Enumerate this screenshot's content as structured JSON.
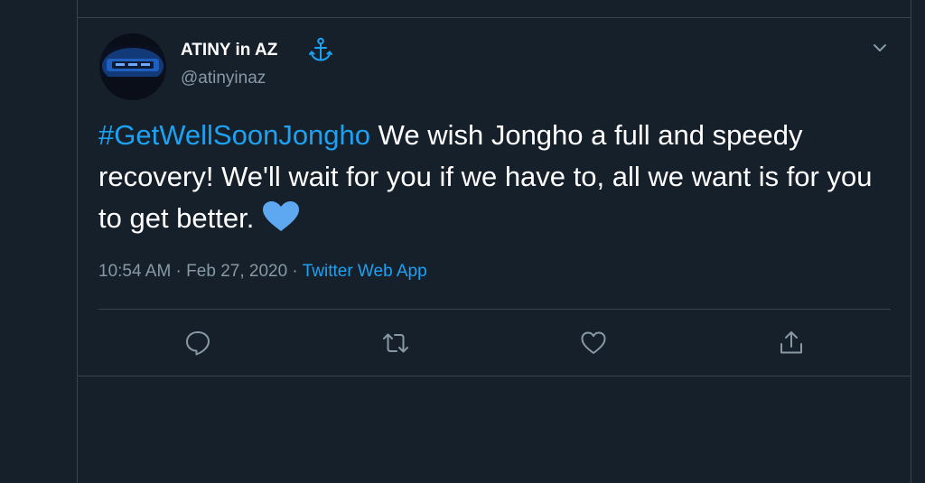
{
  "tweet": {
    "display_name": "ATINY in AZ",
    "handle": "@atinyinaz",
    "hashtag": "#GetWellSoonJongho",
    "body": " We wish Jongho a full and speedy recovery! We'll wait for you if we have to, all we want is for you to get better.",
    "time": "10:54 AM",
    "date": "Feb 27, 2020",
    "separator": " · ",
    "source": "Twitter Web App",
    "icons": {
      "verified_like": "anchor-icon",
      "menu": "chevron-down-icon",
      "emoji": "blue-heart-emoji",
      "actions": [
        "reply-icon",
        "retweet-icon",
        "like-icon",
        "share-icon"
      ]
    }
  },
  "colors": {
    "background": "#15202b",
    "border": "#38444d",
    "accent": "#1da1f2",
    "secondary_text": "#8899a6",
    "heart": "#5da8f0"
  }
}
